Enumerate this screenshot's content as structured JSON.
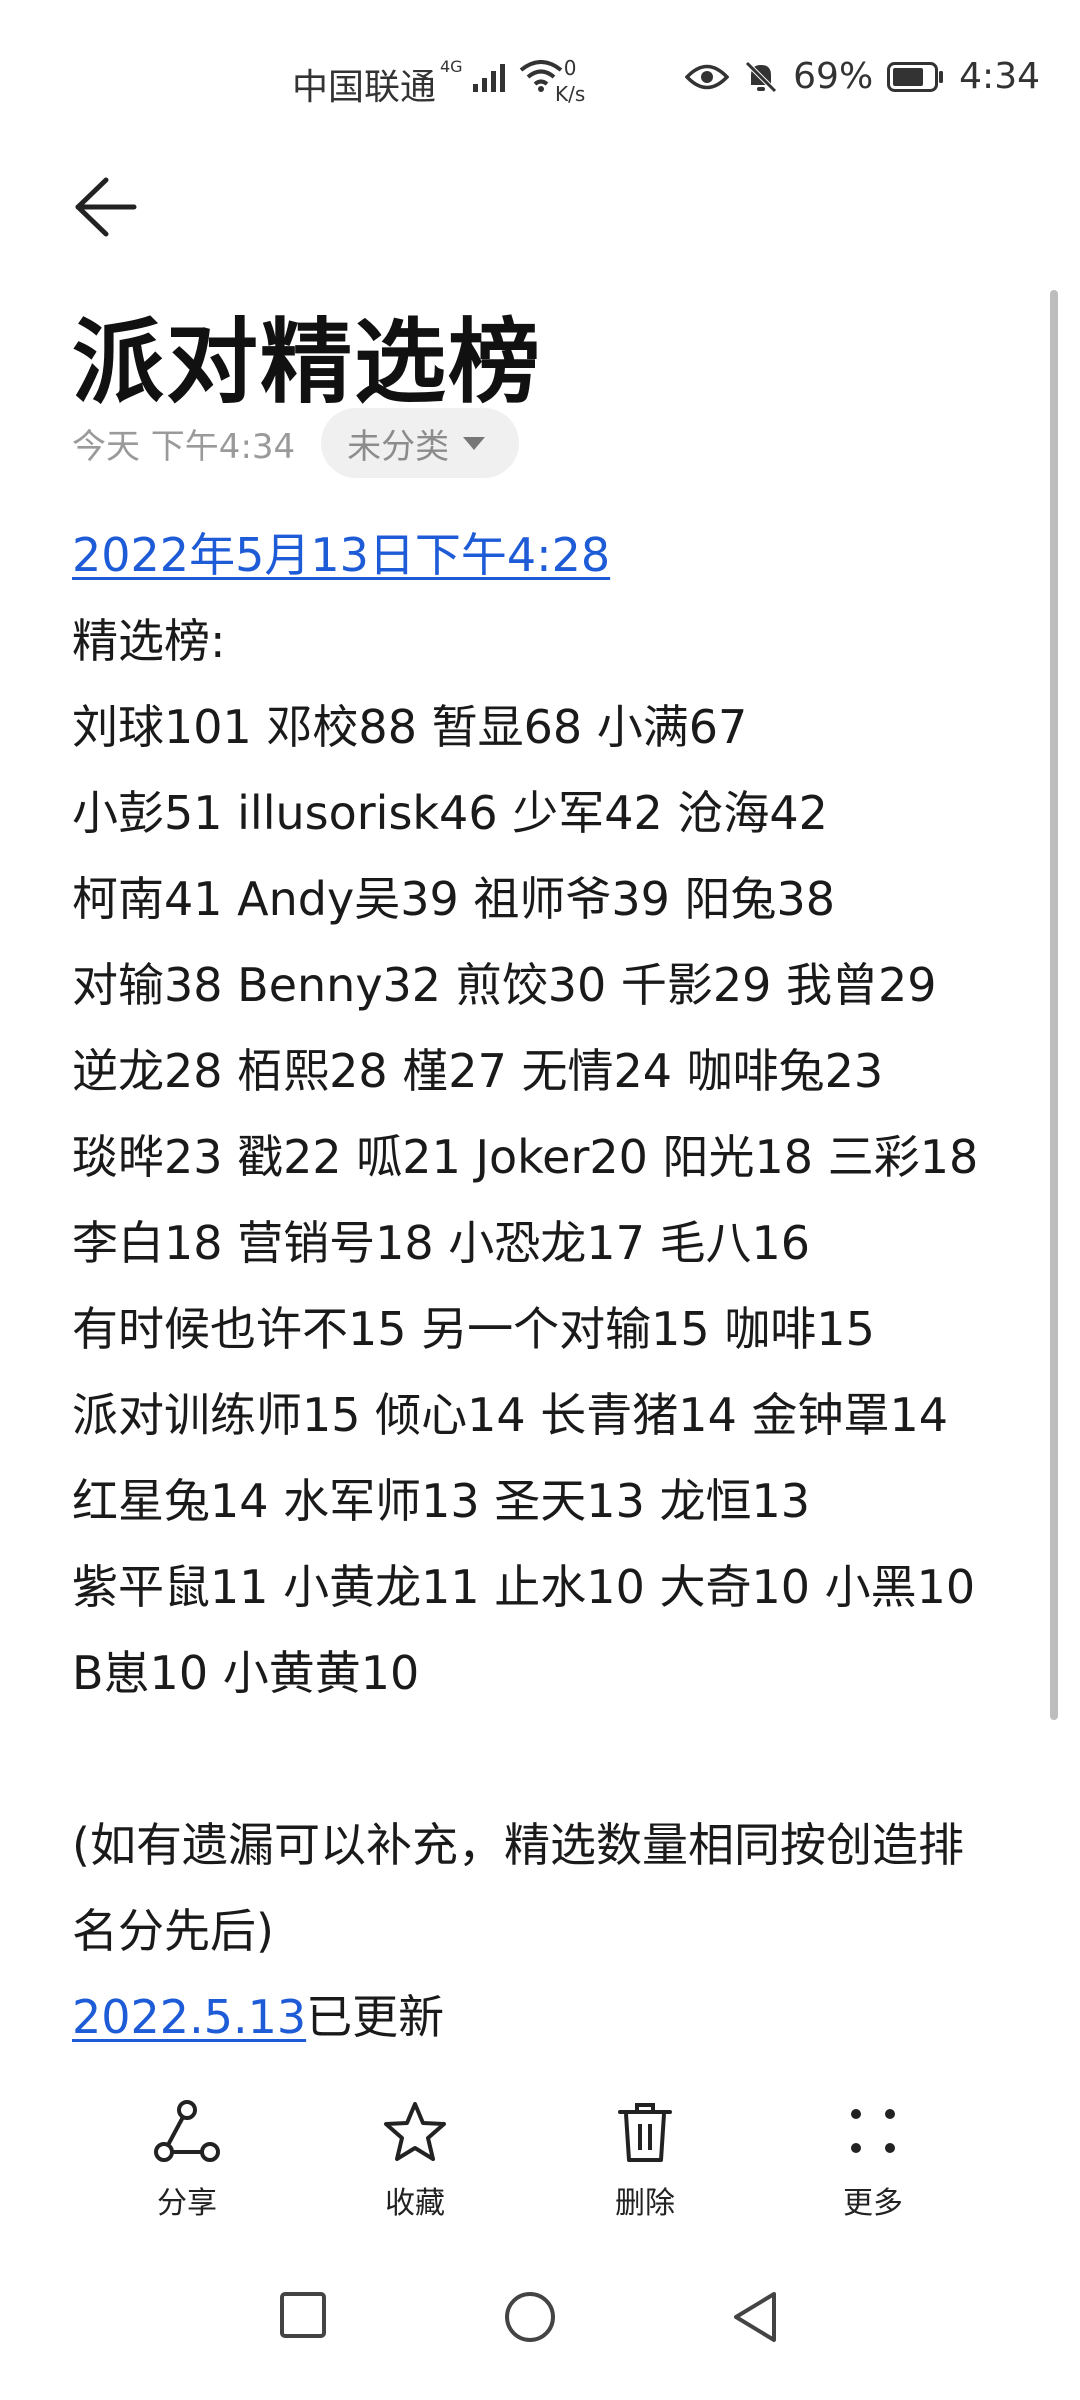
{
  "status_bar": {
    "carrier": "中国联通",
    "network_type": "4G",
    "net_speed_value": "0",
    "net_speed_unit": "K/s",
    "battery": "69%",
    "time": "4:34"
  },
  "note": {
    "title": "派对精选榜",
    "timestamp": "今天 下午4:34",
    "category": "未分类",
    "date_link": "2022年5月13日下午4:28",
    "lines": [
      "精选榜:",
      "刘球101 邓校88 暂显68 小满67",
      "小彭51 illusorisk46 少军42 沧海42",
      "柯南41 Andy吴39 祖师爷39 阳兔38",
      "对输38 Benny32 煎饺30 千影29 我曾29",
      "逆龙28 栢熙28 槿27 无情24 咖啡兔23",
      "琰晔23 戳22 呱21 Joker20 阳光18 三彩18",
      "李白18 营销号18 小恐龙17 毛八16",
      "有时候也许不15 另一个对输15 咖啡15",
      "派对训练师15 倾心14 长青猪14 金钟罩14",
      "红星兔14 水军师13 圣天13 龙恒13",
      "紫平鼠11 小黄龙11 止水10 大奇10 小黑10",
      "B崽10 小黄黄10"
    ],
    "footnote_line1": "(如有遗漏可以补充，精选数量相同按创造排",
    "footnote_line2": "名分先后)",
    "update_link": "2022.5.13",
    "update_suffix": "已更新"
  },
  "toolbar": {
    "share": "分享",
    "favorite": "收藏",
    "delete": "删除",
    "more": "更多"
  },
  "colors": {
    "link": "#1e5bd6",
    "text": "#1a1a1a",
    "muted": "#9a9a9a"
  }
}
